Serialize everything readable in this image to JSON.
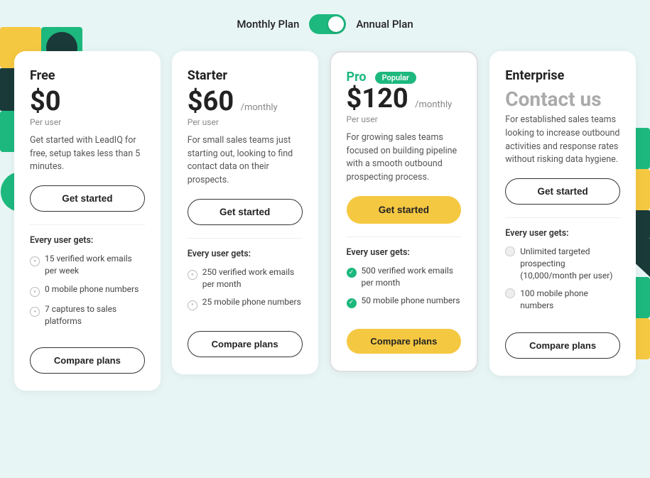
{
  "billing": {
    "monthly_label": "Monthly Plan",
    "annual_label": "Annual Plan",
    "toggle_state": "annual"
  },
  "plans": [
    {
      "id": "free",
      "name": "Free",
      "price": "$0",
      "period": "",
      "per_user": "Per user",
      "description": "Get started with LeadIQ for free, setup takes less than 5 minutes.",
      "cta": "Get started",
      "cta_type": "outline",
      "features_heading": "Every user gets:",
      "features": [
        {
          "text": "15 verified work emails per week",
          "type": "dot"
        },
        {
          "text": "0 mobile phone numbers",
          "type": "dot"
        },
        {
          "text": "7 captures to sales platforms",
          "type": "dot"
        }
      ],
      "compare_label": "Compare plans",
      "compare_type": "outline",
      "popular": false
    },
    {
      "id": "starter",
      "name": "Starter",
      "price": "$60",
      "period": "/monthly",
      "per_user": "Per user",
      "description": "For small sales teams just starting out, looking to find contact data on their prospects.",
      "cta": "Get started",
      "cta_type": "outline",
      "features_heading": "Every user gets:",
      "features": [
        {
          "text": "250 verified work emails per month",
          "type": "dot"
        },
        {
          "text": "25 mobile phone numbers",
          "type": "dot"
        }
      ],
      "compare_label": "Compare plans",
      "compare_type": "outline",
      "popular": false
    },
    {
      "id": "pro",
      "name": "Pro",
      "price": "$120",
      "period": "/monthly",
      "per_user": "Per user",
      "description": "For growing sales teams focused on building pipeline with a smooth outbound prospecting process.",
      "cta": "Get started",
      "cta_type": "yellow",
      "features_heading": "Every user gets:",
      "features": [
        {
          "text": "500 verified work emails per month",
          "type": "check"
        },
        {
          "text": "50 mobile phone numbers",
          "type": "check"
        }
      ],
      "compare_label": "Compare plans",
      "compare_type": "yellow",
      "popular": true,
      "popular_label": "Popular"
    },
    {
      "id": "enterprise",
      "name": "Enterprise",
      "price": "Contact us",
      "period": "",
      "per_user": "",
      "description": "For established sales teams looking to increase outbound activities and response rates without risking data hygiene.",
      "cta": "Get started",
      "cta_type": "outline",
      "features_heading": "Every user gets:",
      "features": [
        {
          "text": "Unlimited targeted prospecting (10,000/month per user)",
          "type": "dot-gray"
        },
        {
          "text": "100 mobile phone numbers",
          "type": "dot-gray"
        }
      ],
      "compare_label": "Compare plans",
      "compare_type": "outline",
      "popular": false
    }
  ]
}
